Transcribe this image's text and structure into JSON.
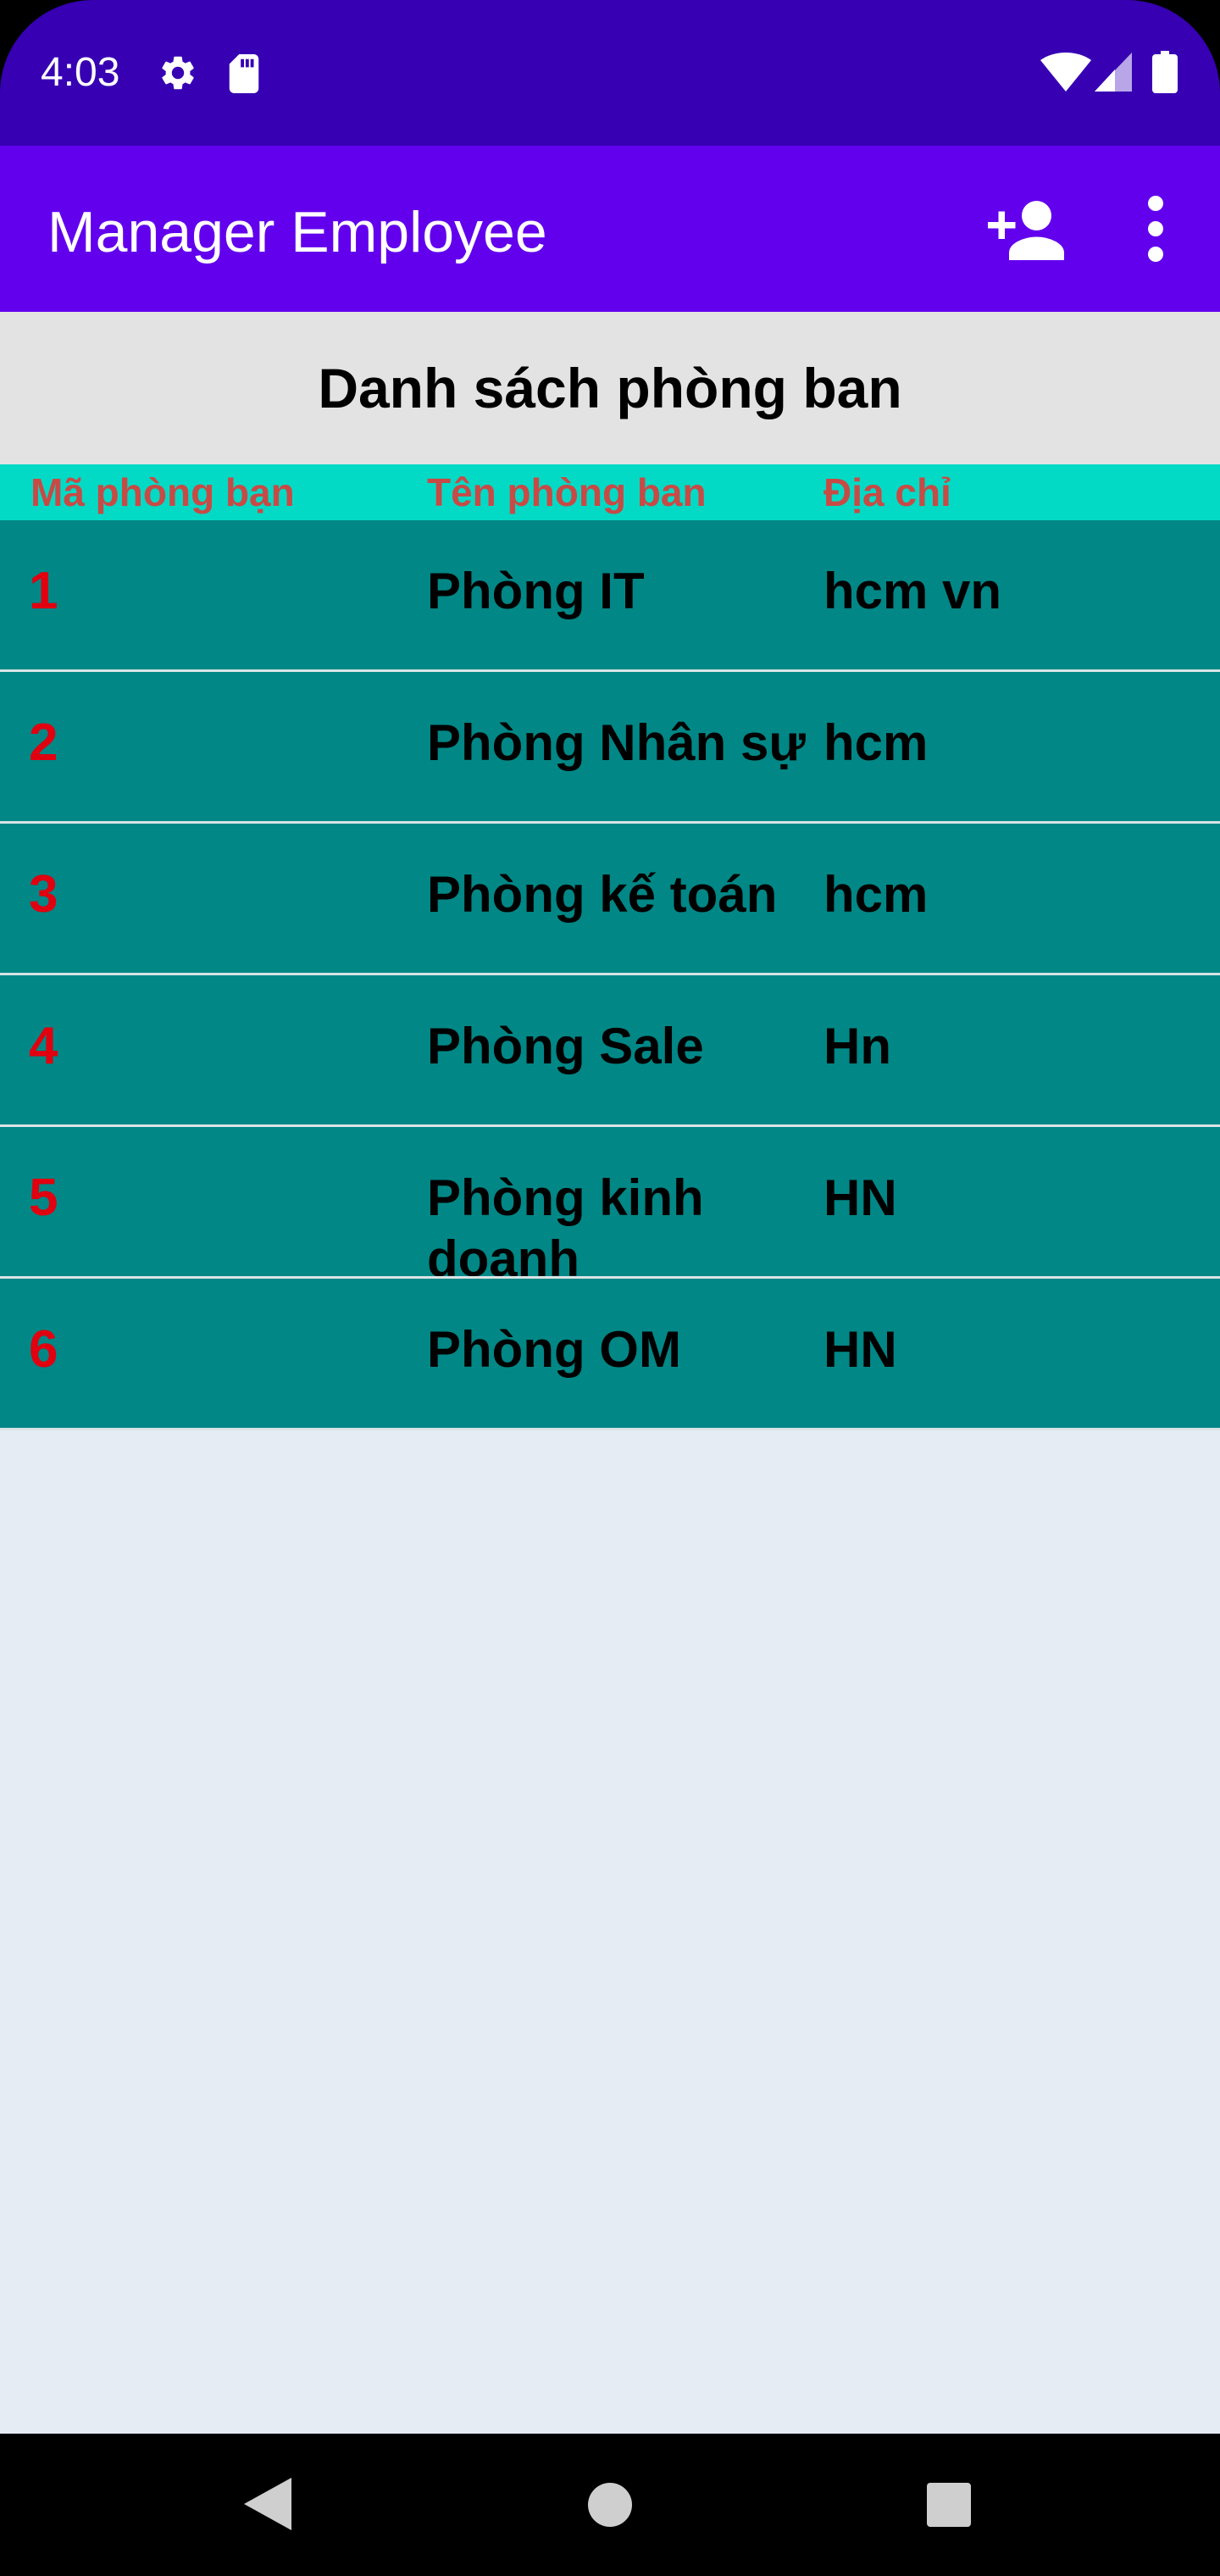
{
  "status_bar": {
    "time": "4:03",
    "icons": [
      "gear-icon",
      "sd-card-icon",
      "wifi-icon",
      "signal-icon",
      "battery-icon"
    ]
  },
  "app_bar": {
    "title": "Manager Employee",
    "actions": [
      "add-person-icon",
      "more-vert-icon"
    ]
  },
  "page": {
    "heading": "Danh sách phòng ban"
  },
  "table": {
    "columns": [
      "Mã phòng bạn",
      "Tên phòng ban",
      "Địa chỉ"
    ],
    "rows": [
      {
        "id": "1",
        "name": "Phòng IT",
        "address": "hcm vn"
      },
      {
        "id": "2",
        "name": "Phòng Nhân sự",
        "address": "hcm"
      },
      {
        "id": "3",
        "name": "Phòng kế toán",
        "address": "hcm"
      },
      {
        "id": "4",
        "name": "Phòng Sale",
        "address": "Hn"
      },
      {
        "id": "5",
        "name": "Phòng kinh doanh",
        "address": "HN"
      },
      {
        "id": "6",
        "name": "Phòng OM",
        "address": "HN"
      }
    ]
  },
  "colors": {
    "status_bar": "#3700b3",
    "app_bar": "#6200ee",
    "header_row": "#03dac5",
    "data_row": "#018786",
    "id_text": "#e0000f",
    "header_text": "#c84a45"
  },
  "nav_bar": {
    "buttons": [
      "back-icon",
      "home-icon",
      "recents-icon"
    ]
  }
}
